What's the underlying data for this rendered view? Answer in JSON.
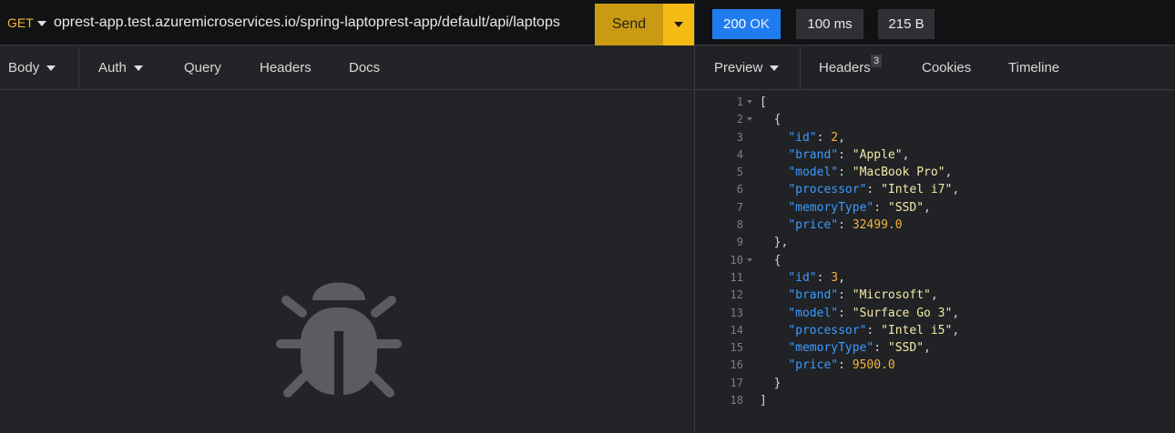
{
  "request": {
    "method": "GET",
    "url": "oprest-app.test.azuremicroservices.io/spring-laptoprest-app/default/api/laptops",
    "send_label": "Send",
    "tabs": {
      "body": "Body",
      "auth": "Auth",
      "query": "Query",
      "headers": "Headers",
      "docs": "Docs"
    }
  },
  "response": {
    "status_code": "200",
    "status_text": "OK",
    "time": "100 ms",
    "size": "215 B",
    "tabs": {
      "preview": "Preview",
      "headers": "Headers",
      "headers_count": "3",
      "cookies": "Cookies",
      "timeline": "Timeline"
    },
    "lines": [
      {
        "n": "1",
        "fold": true,
        "indent": "",
        "punct": "["
      },
      {
        "n": "2",
        "fold": true,
        "indent": "  ",
        "punct": "{"
      },
      {
        "n": "3",
        "indent": "    ",
        "key": "\"id\"",
        "value": "2",
        "vtype": "n",
        "trail": ","
      },
      {
        "n": "4",
        "indent": "    ",
        "key": "\"brand\"",
        "value": "\"Apple\"",
        "vtype": "s",
        "trail": ","
      },
      {
        "n": "5",
        "indent": "    ",
        "key": "\"model\"",
        "value": "\"MacBook Pro\"",
        "vtype": "s",
        "trail": ","
      },
      {
        "n": "6",
        "indent": "    ",
        "key": "\"processor\"",
        "value": "\"Intel i7\"",
        "vtype": "s",
        "trail": ","
      },
      {
        "n": "7",
        "indent": "    ",
        "key": "\"memoryType\"",
        "value": "\"SSD\"",
        "vtype": "s",
        "trail": ","
      },
      {
        "n": "8",
        "indent": "    ",
        "key": "\"price\"",
        "value": "32499.0",
        "vtype": "n",
        "trail": ""
      },
      {
        "n": "9",
        "indent": "  ",
        "punct": "},"
      },
      {
        "n": "10",
        "fold": true,
        "indent": "  ",
        "punct": "{"
      },
      {
        "n": "11",
        "indent": "    ",
        "key": "\"id\"",
        "value": "3",
        "vtype": "n",
        "trail": ","
      },
      {
        "n": "12",
        "indent": "    ",
        "key": "\"brand\"",
        "value": "\"Microsoft\"",
        "vtype": "s",
        "trail": ","
      },
      {
        "n": "13",
        "indent": "    ",
        "key": "\"model\"",
        "value": "\"Surface Go 3\"",
        "vtype": "s",
        "trail": ","
      },
      {
        "n": "14",
        "indent": "    ",
        "key": "\"processor\"",
        "value": "\"Intel i5\"",
        "vtype": "s",
        "trail": ","
      },
      {
        "n": "15",
        "indent": "    ",
        "key": "\"memoryType\"",
        "value": "\"SSD\"",
        "vtype": "s",
        "trail": ","
      },
      {
        "n": "16",
        "indent": "    ",
        "key": "\"price\"",
        "value": "9500.0",
        "vtype": "n",
        "trail": ""
      },
      {
        "n": "17",
        "indent": "  ",
        "punct": "}"
      },
      {
        "n": "18",
        "indent": "",
        "punct": "]"
      }
    ]
  },
  "icons": {
    "empty_state": "bug-icon",
    "dropdown": "caret-down-icon"
  },
  "colors": {
    "accent": "#f5bb12",
    "status_ok": "#1f7cf0",
    "json_key": "#3d9bff",
    "json_string": "#f4e9a6",
    "json_number": "#f3b33d"
  }
}
